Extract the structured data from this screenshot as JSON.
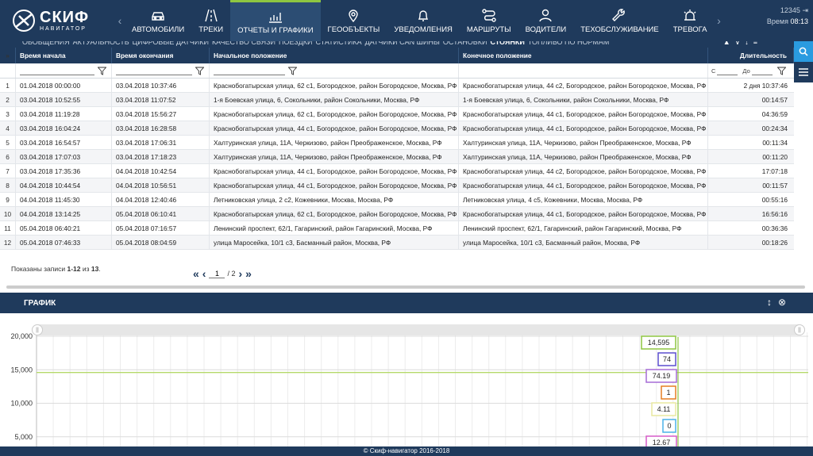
{
  "brand": {
    "name": "СКИФ",
    "sub": "НАВИГАТОР"
  },
  "nav": [
    {
      "label": "АВТОМОБИЛИ",
      "icon": "car-icon"
    },
    {
      "label": "ТРЕКИ",
      "icon": "road-icon"
    },
    {
      "label": "ОТЧЕТЫ И ГРАФИКИ",
      "icon": "chart-icon",
      "active": true
    },
    {
      "label": "ГЕООБЪЕКТЫ",
      "icon": "map-pin-icon"
    },
    {
      "label": "УВЕДОМЛЕНИЯ",
      "icon": "bell-icon"
    },
    {
      "label": "МАРШРУТЫ",
      "icon": "route-icon"
    },
    {
      "label": "ВОДИТЕЛИ",
      "icon": "person-icon"
    },
    {
      "label": "ТЕХОБСЛУЖИВАНИЕ",
      "icon": "wrench-icon"
    },
    {
      "label": "ТРЕВОГА",
      "icon": "alarm-icon"
    }
  ],
  "user": {
    "id": "12345",
    "time_label": "Время",
    "time": "08:13"
  },
  "report_tabs": [
    "ОБОБЩЕНИЯ",
    "АКТУАЛЬНОСТЬ",
    "ЦИФРОВЫЕ ДАТЧИКИ",
    "КАЧЕСТВО СВЯЗИ",
    "ПОЕЗДКИ",
    "СТАТИСТИКА",
    "ДАТЧИКИ CAN ШИНЫ",
    "ОСТАНОВКИ",
    "СТОЯНКИ",
    "ТОПЛИВО ПО НОРМАМ"
  ],
  "active_tab": "СТОЯНКИ",
  "table": {
    "headers": [
      "Время начала",
      "Время окончания",
      "Начальное положение",
      "Конечное положение",
      "Длительность"
    ],
    "filter_from": "С",
    "filter_to": "До",
    "rows": [
      [
        "1",
        "01.04.2018 00:00:00",
        "03.04.2018 10:37:46",
        "Краснобогатырская улица, 62 с1, Богородское, район Богородское, Москва, РФ",
        "Краснобогатырская улица, 44 с2, Богородское, район Богородское, Москва, РФ",
        "2 дня 10:37:46"
      ],
      [
        "2",
        "03.04.2018 10:52:55",
        "03.04.2018 11:07:52",
        "1-я Боевская улица, 6, Сокольники, район Сокольники, Москва, РФ",
        "1-я Боевская улица, 6, Сокольники, район Сокольники, Москва, РФ",
        "00:14:57"
      ],
      [
        "3",
        "03.04.2018 11:19:28",
        "03.04.2018 15:56:27",
        "Краснобогатырская улица, 62 с1, Богородское, район Богородское, Москва, РФ",
        "Краснобогатырская улица, 44 с1, Богородское, район Богородское, Москва, РФ",
        "04:36:59"
      ],
      [
        "4",
        "03.04.2018 16:04:24",
        "03.04.2018 16:28:58",
        "Краснобогатырская улица, 44 с1, Богородское, район Богородское, Москва, РФ",
        "Краснобогатырская улица, 44 с1, Богородское, район Богородское, Москва, РФ",
        "00:24:34"
      ],
      [
        "5",
        "03.04.2018 16:54:57",
        "03.04.2018 17:06:31",
        "Халтуринская улица, 11А, Черкизово, район Преображенское, Москва, РФ",
        "Халтуринская улица, 11А, Черкизово, район Преображенское, Москва, РФ",
        "00:11:34"
      ],
      [
        "6",
        "03.04.2018 17:07:03",
        "03.04.2018 17:18:23",
        "Халтуринская улица, 11А, Черкизово, район Преображенское, Москва, РФ",
        "Халтуринская улица, 11А, Черкизово, район Преображенское, Москва, РФ",
        "00:11:20"
      ],
      [
        "7",
        "03.04.2018 17:35:36",
        "04.04.2018 10:42:54",
        "Краснобогатырская улица, 44 с1, Богородское, район Богородское, Москва, РФ",
        "Краснобогатырская улица, 44 с2, Богородское, район Богородское, Москва, РФ",
        "17:07:18"
      ],
      [
        "8",
        "04.04.2018 10:44:54",
        "04.04.2018 10:56:51",
        "Краснобогатырская улица, 44 с1, Богородское, район Богородское, Москва, РФ",
        "Краснобогатырская улица, 44 с1, Богородское, район Богородское, Москва, РФ",
        "00:11:57"
      ],
      [
        "9",
        "04.04.2018 11:45:30",
        "04.04.2018 12:40:46",
        "Летниковская улица, 2 с2, Кожевники, Москва, Москва, РФ",
        "Летниковская улица, 4 с5, Кожевники, Москва, Москва, РФ",
        "00:55:16"
      ],
      [
        "10",
        "04.04.2018 13:14:25",
        "05.04.2018 06:10:41",
        "Краснобогатырская улица, 62 с1, Богородское, район Богородское, Москва, РФ",
        "Краснобогатырская улица, 44 с1, Богородское, район Богородское, Москва, РФ",
        "16:56:16"
      ],
      [
        "11",
        "05.04.2018 06:40:21",
        "05.04.2018 07:16:57",
        "Ленинский проспект, 62/1, Гагаринский, район Гагаринский, Москва, РФ",
        "Ленинский проспект, 62/1, Гагаринский, район Гагаринский, Москва, РФ",
        "00:36:36"
      ],
      [
        "12",
        "05.04.2018 07:46:33",
        "05.04.2018 08:04:59",
        "улица Маросейка, 10/1 с3, Басманный район, Москва, РФ",
        "улица Маросейка, 10/1 с3, Басманный район, Москва, РФ",
        "00:18:26"
      ]
    ]
  },
  "pager": {
    "prefix": "Показаны записи ",
    "range": "1-12",
    "mid": " из ",
    "total": "13",
    "suffix": ".",
    "page": "1",
    "of": "/ 2"
  },
  "chart_panel": {
    "title": "ГРАФИК"
  },
  "chart_data": {
    "type": "line",
    "yticks": [
      "20,000",
      "15,000",
      "10,000",
      "5,000"
    ],
    "ylim": [
      0,
      20000
    ],
    "grid": true,
    "threshold": 14595,
    "tooltips": [
      {
        "value": "14,595",
        "color": "#8ec641"
      },
      {
        "value": "74",
        "color": "#5b4fcf"
      },
      {
        "value": "74.19",
        "color": "#a56bd6"
      },
      {
        "value": "1",
        "color": "#e67e22"
      },
      {
        "value": "4.11",
        "color": "#e8e8a0"
      },
      {
        "value": "0",
        "color": "#4ab2e8"
      },
      {
        "value": "12.67",
        "color": "#d65bc8"
      }
    ]
  },
  "footer": "© Скиф-навигатор 2016-2018"
}
